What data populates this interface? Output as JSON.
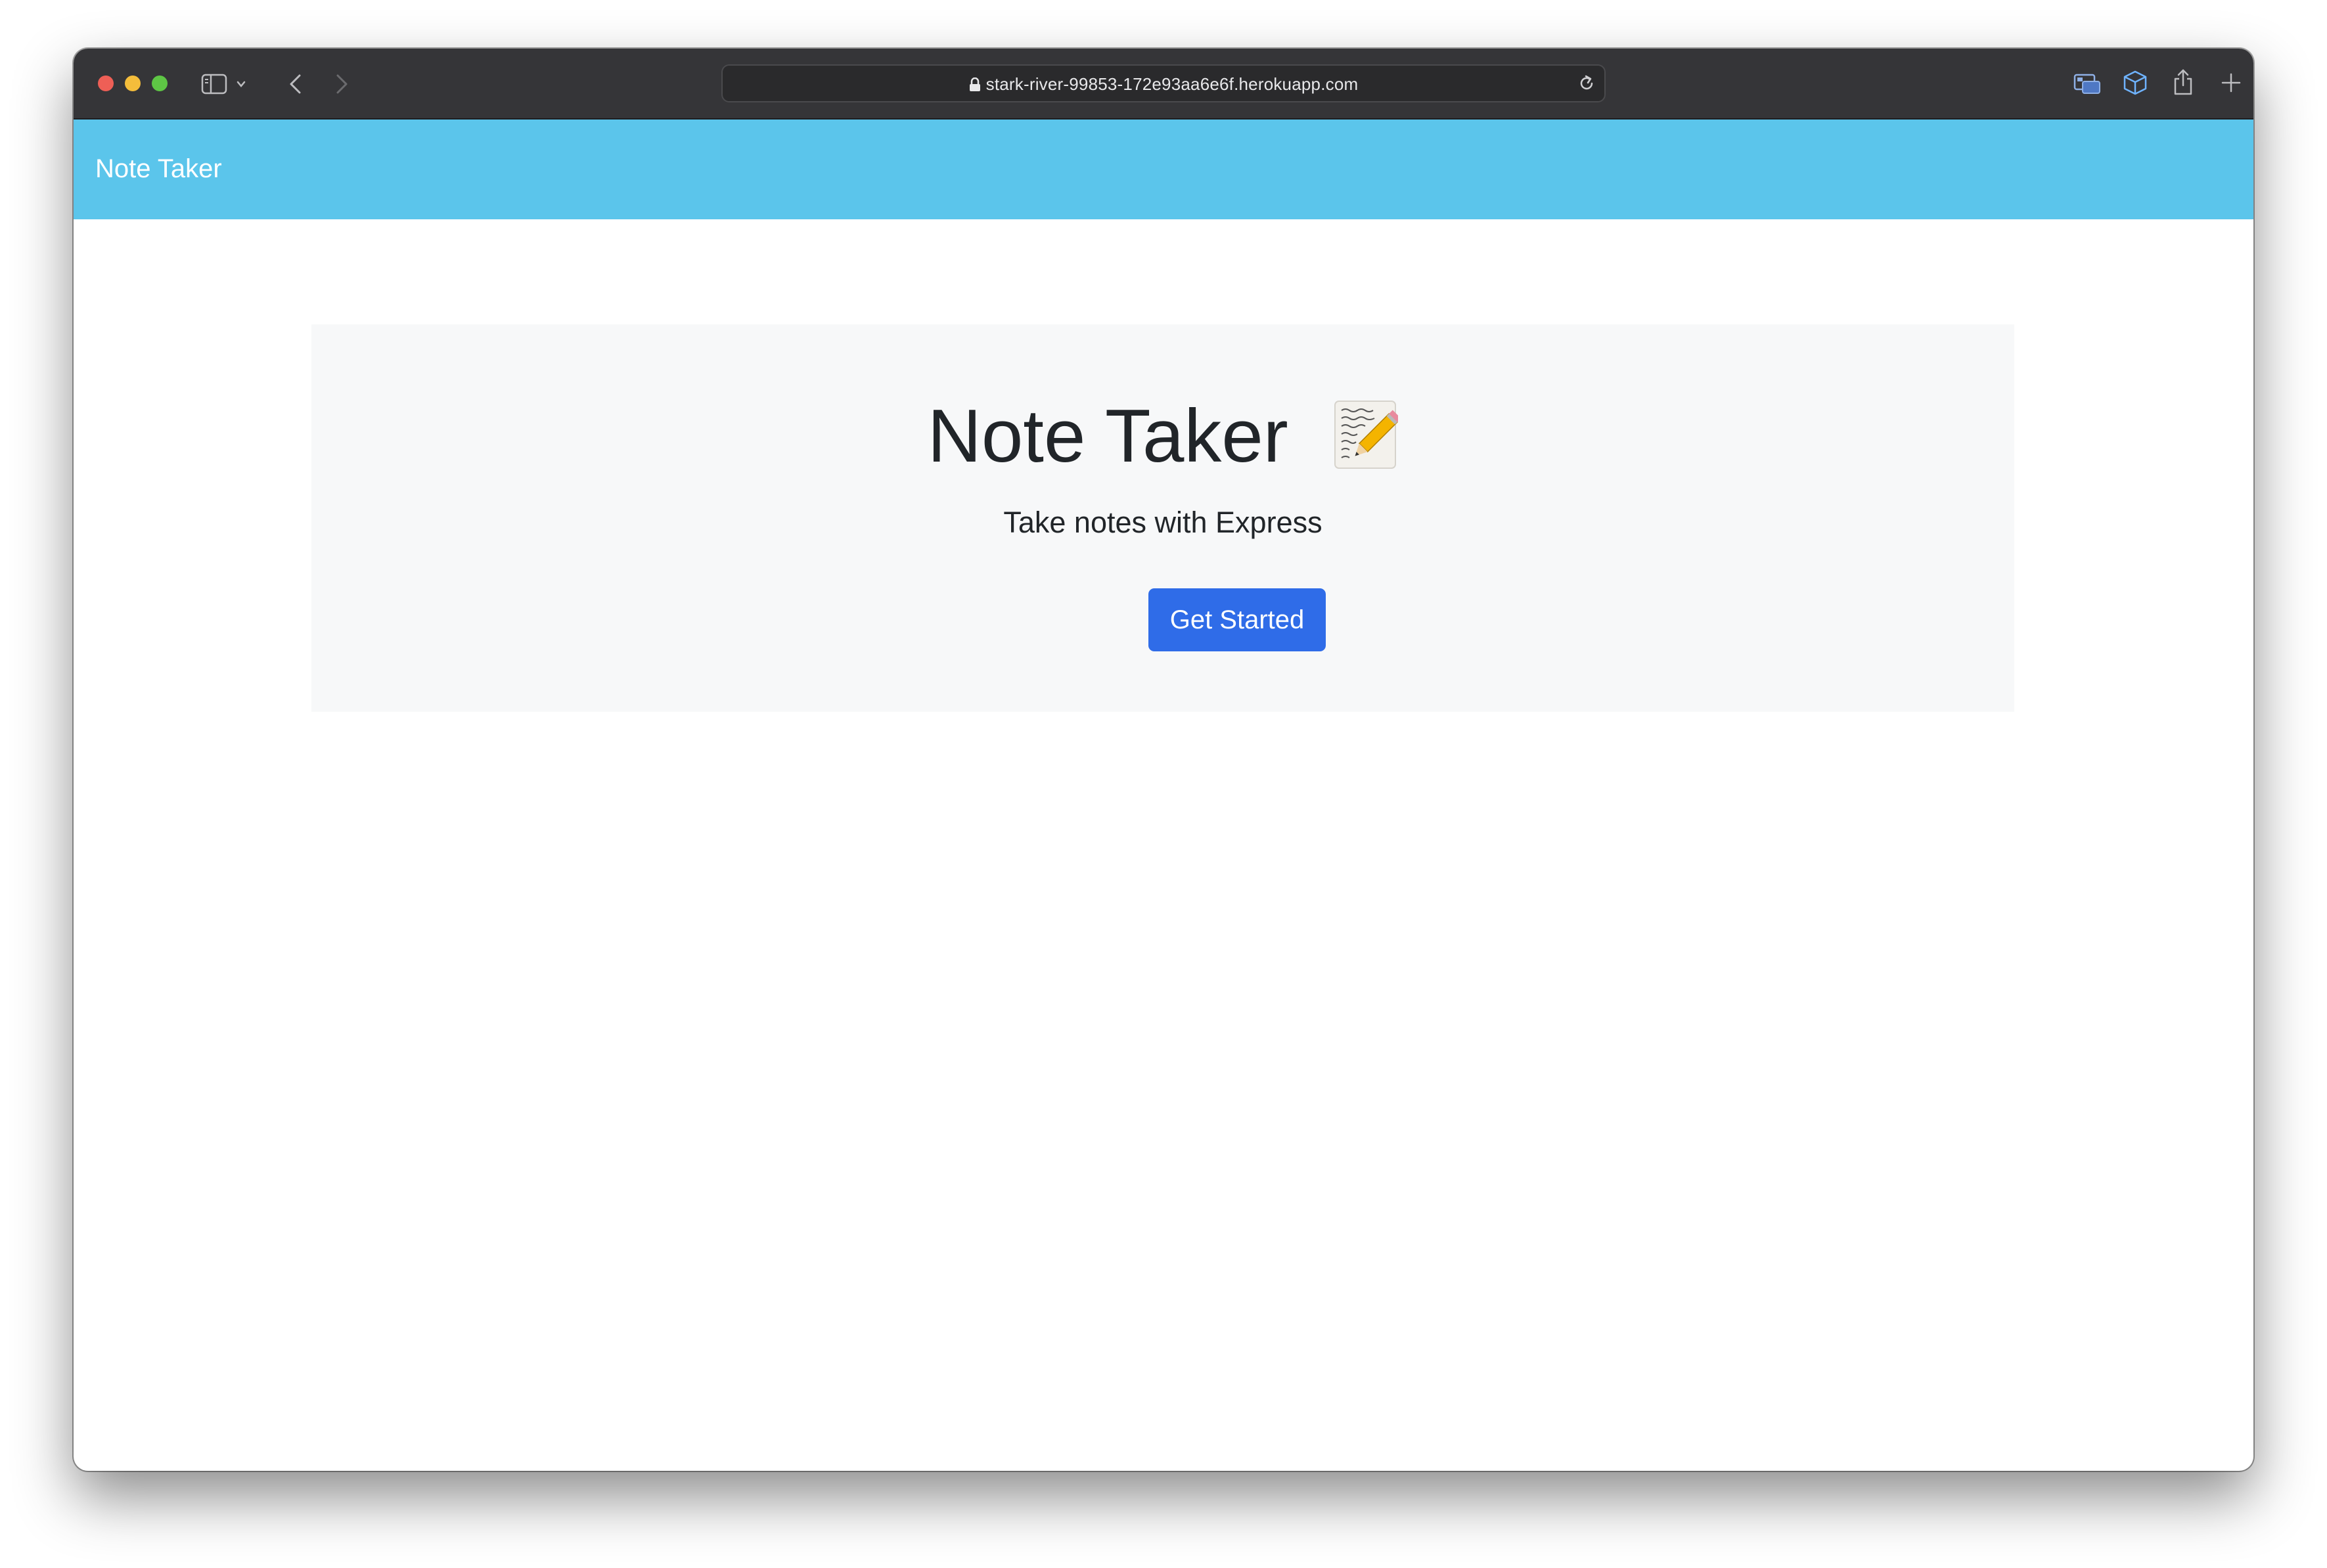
{
  "browser": {
    "url": "stark-river-99853-172e93aa6e6f.herokuapp.com",
    "colors": {
      "close": "#ee5f56",
      "minimize": "#f4bd3b",
      "maximize": "#5ec645",
      "toolbar": "#353538"
    }
  },
  "navbar": {
    "brand": "Note Taker",
    "color": "#5bc5eb"
  },
  "hero": {
    "title": "Note Taker",
    "emoji_icon": "memo-icon",
    "subtitle": "Take notes with Express",
    "button_label": "Get Started",
    "button_color": "#2f6ce8"
  }
}
